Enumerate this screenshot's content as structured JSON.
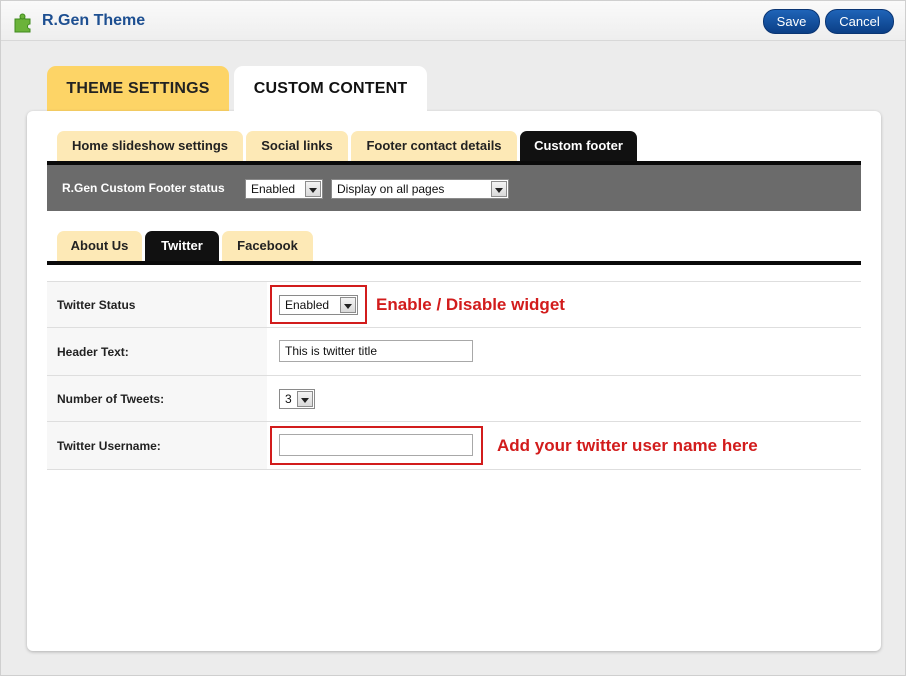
{
  "app": {
    "title": "R.Gen Theme",
    "icon": "puzzle-piece-icon"
  },
  "toolbar": {
    "save_label": "Save",
    "cancel_label": "Cancel"
  },
  "main_tabs": [
    {
      "label": "THEME SETTINGS",
      "active": false
    },
    {
      "label": "CUSTOM CONTENT",
      "active": true
    }
  ],
  "sub_tabs": [
    {
      "label": "Home slideshow settings",
      "active": false
    },
    {
      "label": "Social links",
      "active": false
    },
    {
      "label": "Footer contact details",
      "active": false
    },
    {
      "label": "Custom footer",
      "active": true
    }
  ],
  "footer_status": {
    "label": "R.Gen Custom Footer status",
    "status_value": "Enabled",
    "display_value": "Display on all pages"
  },
  "widget_tabs": [
    {
      "label": "About Us",
      "active": false
    },
    {
      "label": "Twitter",
      "active": true
    },
    {
      "label": "Facebook",
      "active": false
    }
  ],
  "twitter_form": {
    "status_label": "Twitter Status",
    "status_value": "Enabled",
    "header_label": "Header Text:",
    "header_value": "This is twitter title",
    "tweets_label": "Number of Tweets:",
    "tweets_value": "3",
    "username_label": "Twitter Username:",
    "username_value": ""
  },
  "annotations": {
    "status_note": "Enable / Disable widget",
    "username_note": "Add your twitter user name here"
  },
  "colors": {
    "brand_blue": "#1d4f91",
    "button_blue": "#0b3f86",
    "tab_yellow": "#fdd466",
    "subtab_cream": "#fde9b6",
    "annotation_red": "#d21c1c"
  }
}
